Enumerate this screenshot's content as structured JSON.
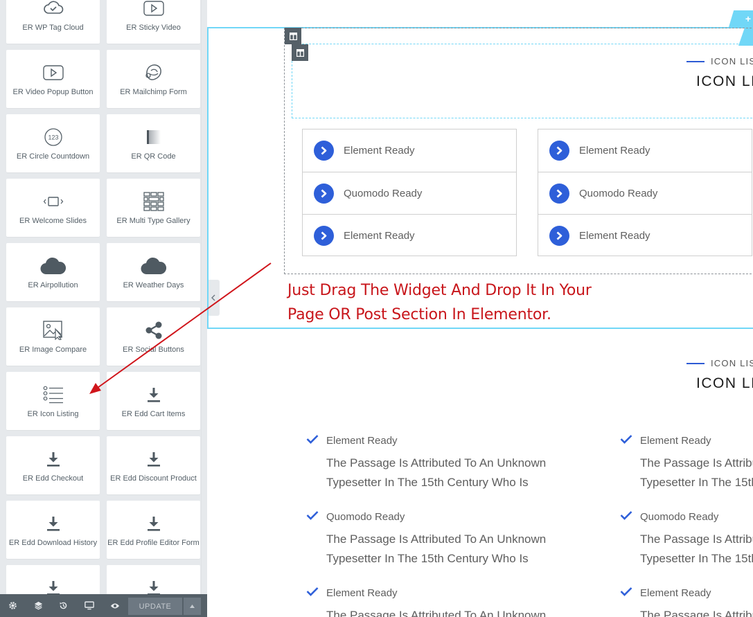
{
  "panel": {
    "widgets": [
      {
        "label": "ER WP Tag Cloud",
        "icon": "tag-cloud-icon"
      },
      {
        "label": "ER Sticky Video",
        "icon": "play-icon"
      },
      {
        "label": "ER Video Popup Button",
        "icon": "video-play-icon"
      },
      {
        "label": "ER Mailchimp Form",
        "icon": "mailchimp-icon"
      },
      {
        "label": "ER Circle Countdown",
        "icon": "counter-icon"
      },
      {
        "label": "ER QR Code",
        "icon": "qr-code-icon"
      },
      {
        "label": "ER Welcome Slides",
        "icon": "slides-icon"
      },
      {
        "label": "ER Multi Type Gallery",
        "icon": "gallery-grid-icon"
      },
      {
        "label": "ER Airpollution",
        "icon": "cloud-icon"
      },
      {
        "label": "ER Weather Days",
        "icon": "cloud-icon"
      },
      {
        "label": "ER Image Compare",
        "icon": "image-compare-icon"
      },
      {
        "label": "ER Social Buttons",
        "icon": "share-icon"
      },
      {
        "label": "ER Icon Listing",
        "icon": "list-icon"
      },
      {
        "label": "ER Edd Cart Items",
        "icon": "download-icon"
      },
      {
        "label": "ER Edd Checkout",
        "icon": "download-icon"
      },
      {
        "label": "ER Edd Discount Product",
        "icon": "download-icon"
      },
      {
        "label": "ER Edd Download History",
        "icon": "download-icon"
      },
      {
        "label": "ER Edd Profile Editor Form",
        "icon": "download-icon"
      },
      {
        "label": "",
        "icon": "download-icon"
      },
      {
        "label": "",
        "icon": "download-icon"
      }
    ],
    "footer": {
      "tools": [
        "settings-icon",
        "layers-icon",
        "history-icon",
        "responsive-icon",
        "preview-icon"
      ],
      "update_label": "UPDATE"
    }
  },
  "canvas": {
    "top_widget": {
      "subtitle": "ICON LIS",
      "title": "ICON LI",
      "lists": [
        [
          "Element Ready",
          "Quomodo Ready",
          "Element Ready"
        ],
        [
          "Element Ready",
          "Quomodo Ready",
          "Element Ready"
        ]
      ]
    },
    "annotation": {
      "line1": "Just Drag The Widget And Drop It In Your",
      "line2": "Page OR Post Section In Elementor."
    },
    "bottom_widget": {
      "subtitle": "ICON LIS",
      "title": "ICON LI",
      "items_left": [
        {
          "title": "Element Ready",
          "desc1": "The Passage Is Attributed To An Unknown",
          "desc2": "Typesetter In The 15th Century Who Is"
        },
        {
          "title": "Quomodo Ready",
          "desc1": "The Passage Is Attributed To An Unknown",
          "desc2": "Typesetter In The 15th Century Who Is"
        },
        {
          "title": "Element Ready",
          "desc1": "The Passage Is Attributed To An Unknown",
          "desc2": ""
        }
      ],
      "items_right": [
        {
          "title": "Element Ready",
          "desc1": "The Passage Is Attribu",
          "desc2": "Typesetter In The 15th"
        },
        {
          "title": "Quomodo Ready",
          "desc1": "The Passage Is Attribu",
          "desc2": "Typesetter In The 15th"
        },
        {
          "title": "Element Ready",
          "desc1": "The Passage Is Attribu",
          "desc2": ""
        }
      ]
    }
  },
  "colors": {
    "accent": "#2e5fd9",
    "annotation": "#c8161b",
    "section_border": "#71d7f7",
    "panel_footer": "#556068"
  }
}
